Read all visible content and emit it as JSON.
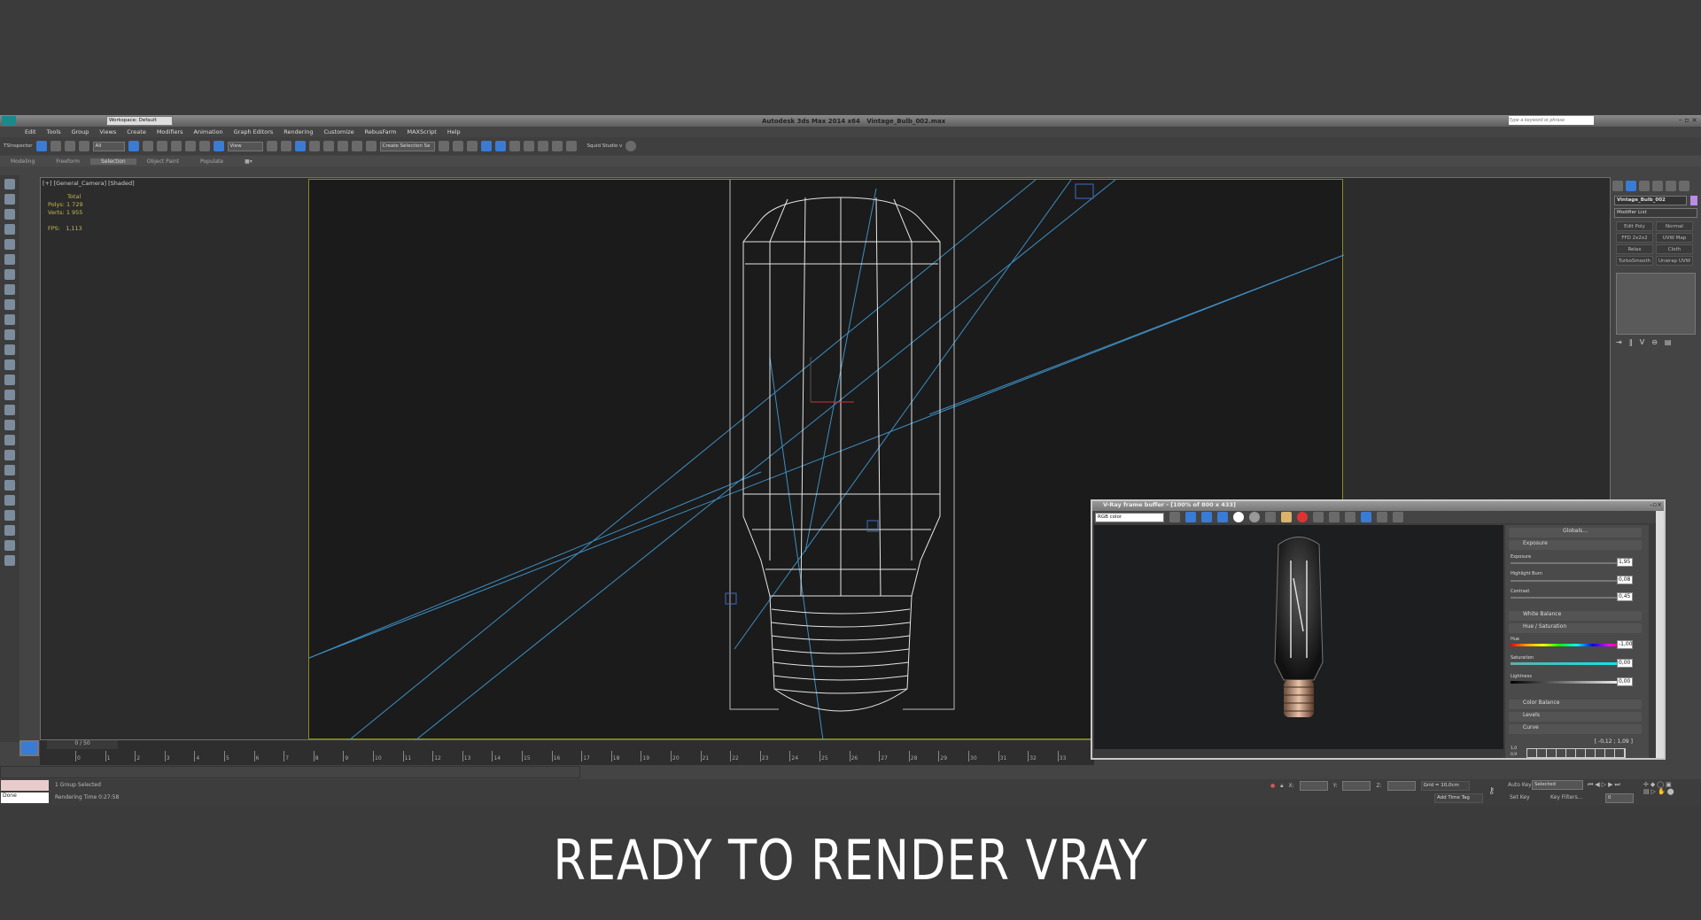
{
  "titlebar": {
    "app_title": "Autodesk 3ds Max 2014 x64",
    "file": "Vintage_Bulb_002.max",
    "workspace": "Workspace: Default",
    "search_placeholder": "Type a keyword or phrase"
  },
  "menu": [
    "Edit",
    "Tools",
    "Group",
    "Views",
    "Create",
    "Modifiers",
    "Animation",
    "Graph Editors",
    "Rendering",
    "Customize",
    "RebusFarm",
    "MAXScript",
    "Help"
  ],
  "toolbar": {
    "inspector": "TSInspector",
    "filter": "All",
    "ref_coord": "View",
    "selection_set": "Create Selection Se",
    "squid": "Squid Studio v"
  },
  "ribbon": {
    "tabs": [
      "Modeling",
      "Freeform",
      "Selection",
      "Object Paint",
      "Populate"
    ],
    "active": "Selection"
  },
  "viewport": {
    "label": "[+] [General_Camera] [Shaded]",
    "stats_header": "Total",
    "polys_label": "Polys:",
    "polys": "1 729",
    "verts_label": "Verts:",
    "verts": "1 955",
    "fps_label": "FPS:",
    "fps": "1,113"
  },
  "command_panel": {
    "object_name": "Vintage_Bulb_002",
    "object_color": "#b98ce8",
    "modifier_list": "Modifier List",
    "modifiers": [
      "Edit Poly",
      "Normal",
      "FFD 2x2x2",
      "UVW Map",
      "Relax",
      "Cloth",
      "TurboSmooth",
      "Unwrap UVW"
    ]
  },
  "timeline": {
    "frame": "0 / 50",
    "ticks": [
      "0",
      "1",
      "2",
      "3",
      "4",
      "5",
      "6",
      "7",
      "8",
      "9",
      "10",
      "11",
      "12",
      "13",
      "14",
      "15",
      "16",
      "17",
      "18",
      "19",
      "20",
      "21",
      "22",
      "23",
      "24",
      "25",
      "26",
      "27",
      "28",
      "29",
      "30",
      "31",
      "32",
      "33"
    ]
  },
  "status": {
    "script_result": "Done",
    "selection": "1 Group Selected",
    "render_time": "Rendering Time  0:27:58",
    "x_label": "X:",
    "y_label": "Y:",
    "z_label": "Z:",
    "grid": "Grid = 10,0cm",
    "add_time_tag": "Add Time Tag",
    "auto_key": "Auto Key",
    "set_key": "Set Key",
    "key_mode": "Selected",
    "key_filters": "Key Filters...",
    "frame_field": "0"
  },
  "vfb": {
    "title": "V-Ray frame buffer - [100% of 800 x 433]",
    "channel": "RGB color",
    "globals": "Globals...",
    "exposure_section": "Exposure",
    "exposure_label": "Exposure",
    "exposure": "1,95",
    "highlight_label": "Highlight Burn",
    "highlight": "0,08",
    "contrast_label": "Contrast",
    "contrast": "0,45",
    "white_balance": "White Balance",
    "hue_sat": "Hue / Saturation",
    "hue_label": "Hue",
    "hue": "-1,00",
    "sat_label": "Saturation",
    "sat": "0,00",
    "light_label": "Lightness",
    "light": "0,00",
    "color_balance": "Color Balance",
    "levels": "Levels",
    "curve": "Curve",
    "curve_range": "[ -0,12 ; 1,09 ]",
    "curve_y1": "1,0",
    "curve_y2": "0,9"
  },
  "caption": "READY TO RENDER  VRAY"
}
